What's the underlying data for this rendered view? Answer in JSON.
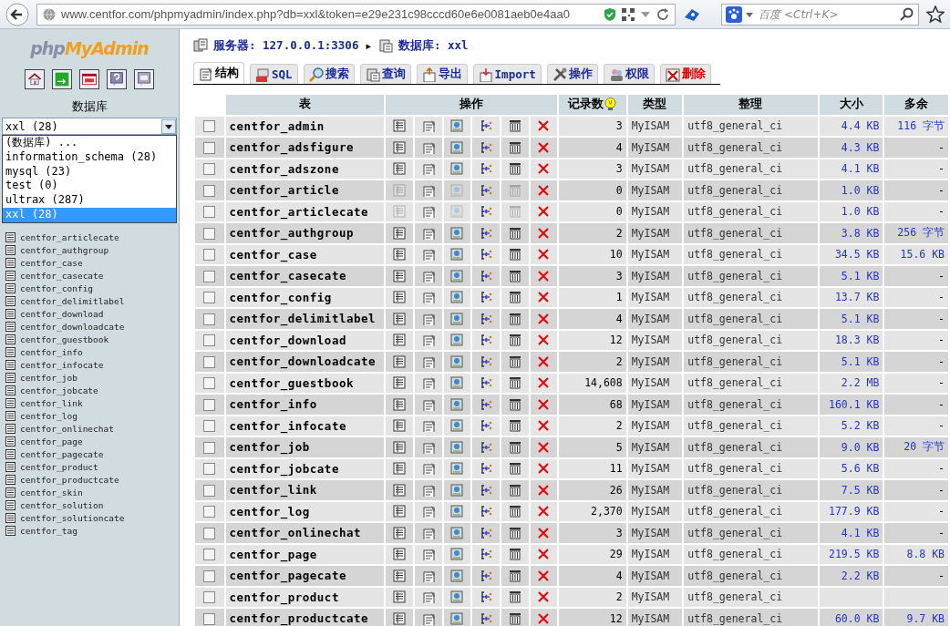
{
  "browser": {
    "url": "www.centfor.com/phpmyadmin/index.php?db=xxl&token=e29e231c98cccd60e6e0081aeb0e4aa0",
    "search_placeholder": "百度 <Ctrl+K>"
  },
  "sidebar": {
    "logo": [
      "php",
      "MyAdmin"
    ],
    "db_label": "数据库",
    "db_select": {
      "value": "xxl (28)",
      "options": [
        {
          "label": "(数据库) ...",
          "selected": false
        },
        {
          "label": "information_schema (28)",
          "selected": false
        },
        {
          "label": "mysql (23)",
          "selected": false
        },
        {
          "label": "test (0)",
          "selected": false
        },
        {
          "label": "ultrax (287)",
          "selected": false
        },
        {
          "label": "xxl (28)",
          "selected": true
        }
      ]
    },
    "tables": [
      "centfor_articlecate",
      "centfor_authgroup",
      "centfor_case",
      "centfor_casecate",
      "centfor_config",
      "centfor_delimitlabel",
      "centfor_download",
      "centfor_downloadcate",
      "centfor_guestbook",
      "centfor_info",
      "centfor_infocate",
      "centfor_job",
      "centfor_jobcate",
      "centfor_link",
      "centfor_log",
      "centfor_onlinechat",
      "centfor_page",
      "centfor_pagecate",
      "centfor_product",
      "centfor_productcate",
      "centfor_skin",
      "centfor_solution",
      "centfor_solutioncate",
      "centfor_tag"
    ]
  },
  "breadcrumb": {
    "server": "服务器: 127.0.0.1:3306",
    "separator": "▸",
    "database": "数据库: xxl"
  },
  "tabs": [
    {
      "label": "结构",
      "kind": "normal",
      "selected": true
    },
    {
      "label": "SQL",
      "kind": "normal",
      "selected": false
    },
    {
      "label": "搜索",
      "kind": "normal",
      "selected": false
    },
    {
      "label": "查询",
      "kind": "normal",
      "selected": false
    },
    {
      "label": "导出",
      "kind": "normal",
      "selected": false
    },
    {
      "label": "Import",
      "kind": "normal",
      "selected": false
    },
    {
      "label": "操作",
      "kind": "normal",
      "selected": false
    },
    {
      "label": "权限",
      "kind": "normal",
      "selected": false
    },
    {
      "label": "删除",
      "kind": "danger",
      "selected": false
    }
  ],
  "table": {
    "columns": [
      "表",
      "操作",
      "记录数",
      "类型",
      "整理",
      "大小",
      "多余"
    ],
    "rows": [
      {
        "name": "centfor_admin",
        "records": "3",
        "type": "MyISAM",
        "collation": "utf8_general_ci",
        "size": "4.4 KB",
        "overhead": "116 字节",
        "browsable": true,
        "checked": false
      },
      {
        "name": "centfor_adsfigure",
        "records": "4",
        "type": "MyISAM",
        "collation": "utf8_general_ci",
        "size": "4.3 KB",
        "overhead": "-",
        "browsable": true,
        "checked": false
      },
      {
        "name": "centfor_adszone",
        "records": "3",
        "type": "MyISAM",
        "collation": "utf8_general_ci",
        "size": "4.1 KB",
        "overhead": "-",
        "browsable": true,
        "checked": false
      },
      {
        "name": "centfor_article",
        "records": "0",
        "type": "MyISAM",
        "collation": "utf8_general_ci",
        "size": "1.0 KB",
        "overhead": "-",
        "browsable": false,
        "checked": false
      },
      {
        "name": "centfor_articlecate",
        "records": "0",
        "type": "MyISAM",
        "collation": "utf8_general_ci",
        "size": "1.0 KB",
        "overhead": "-",
        "browsable": false,
        "checked": false
      },
      {
        "name": "centfor_authgroup",
        "records": "2",
        "type": "MyISAM",
        "collation": "utf8_general_ci",
        "size": "3.8 KB",
        "overhead": "256 字节",
        "browsable": true,
        "checked": false
      },
      {
        "name": "centfor_case",
        "records": "10",
        "type": "MyISAM",
        "collation": "utf8_general_ci",
        "size": "34.5 KB",
        "overhead": "15.6 KB",
        "browsable": true,
        "checked": false
      },
      {
        "name": "centfor_casecate",
        "records": "3",
        "type": "MyISAM",
        "collation": "utf8_general_ci",
        "size": "5.1 KB",
        "overhead": "-",
        "browsable": true,
        "checked": false
      },
      {
        "name": "centfor_config",
        "records": "1",
        "type": "MyISAM",
        "collation": "utf8_general_ci",
        "size": "13.7 KB",
        "overhead": "-",
        "browsable": true,
        "checked": false
      },
      {
        "name": "centfor_delimitlabel",
        "records": "4",
        "type": "MyISAM",
        "collation": "utf8_general_ci",
        "size": "5.1 KB",
        "overhead": "-",
        "browsable": true,
        "checked": false
      },
      {
        "name": "centfor_download",
        "records": "12",
        "type": "MyISAM",
        "collation": "utf8_general_ci",
        "size": "18.3 KB",
        "overhead": "-",
        "browsable": true,
        "checked": false
      },
      {
        "name": "centfor_downloadcate",
        "records": "2",
        "type": "MyISAM",
        "collation": "utf8_general_ci",
        "size": "5.1 KB",
        "overhead": "-",
        "browsable": true,
        "checked": false
      },
      {
        "name": "centfor_guestbook",
        "records": "14,608",
        "type": "MyISAM",
        "collation": "utf8_general_ci",
        "size": "2.2 MB",
        "overhead": "-",
        "browsable": true,
        "checked": false
      },
      {
        "name": "centfor_info",
        "records": "68",
        "type": "MyISAM",
        "collation": "utf8_general_ci",
        "size": "160.1 KB",
        "overhead": "-",
        "browsable": true,
        "checked": false
      },
      {
        "name": "centfor_infocate",
        "records": "2",
        "type": "MyISAM",
        "collation": "utf8_general_ci",
        "size": "5.2 KB",
        "overhead": "-",
        "browsable": true,
        "checked": false
      },
      {
        "name": "centfor_job",
        "records": "5",
        "type": "MyISAM",
        "collation": "utf8_general_ci",
        "size": "9.0 KB",
        "overhead": "20 字节",
        "browsable": true,
        "checked": false
      },
      {
        "name": "centfor_jobcate",
        "records": "11",
        "type": "MyISAM",
        "collation": "utf8_general_ci",
        "size": "5.6 KB",
        "overhead": "-",
        "browsable": true,
        "checked": false
      },
      {
        "name": "centfor_link",
        "records": "26",
        "type": "MyISAM",
        "collation": "utf8_general_ci",
        "size": "7.5 KB",
        "overhead": "-",
        "browsable": true,
        "checked": false
      },
      {
        "name": "centfor_log",
        "records": "2,370",
        "type": "MyISAM",
        "collation": "utf8_general_ci",
        "size": "177.9 KB",
        "overhead": "-",
        "browsable": true,
        "checked": false
      },
      {
        "name": "centfor_onlinechat",
        "records": "3",
        "type": "MyISAM",
        "collation": "utf8_general_ci",
        "size": "4.1 KB",
        "overhead": "-",
        "browsable": true,
        "checked": false
      },
      {
        "name": "centfor_page",
        "records": "29",
        "type": "MyISAM",
        "collation": "utf8_general_ci",
        "size": "219.5 KB",
        "overhead": "8.8 KB",
        "browsable": true,
        "checked": false
      },
      {
        "name": "centfor_pagecate",
        "records": "4",
        "type": "MyISAM",
        "collation": "utf8_general_ci",
        "size": "2.2 KB",
        "overhead": "-",
        "browsable": true,
        "checked": false
      },
      {
        "name": "centfor_product",
        "records": "2",
        "type": "MyISAM",
        "collation": "utf8_general_ci",
        "browsable": true,
        "checked": false
      },
      {
        "name": "centfor_productcate",
        "records": "12",
        "type": "MyISAM",
        "collation": "utf8_general_ci",
        "size": "60.0 KB",
        "overhead": "9.7 KB",
        "browsable": true,
        "checked": false
      }
    ]
  }
}
